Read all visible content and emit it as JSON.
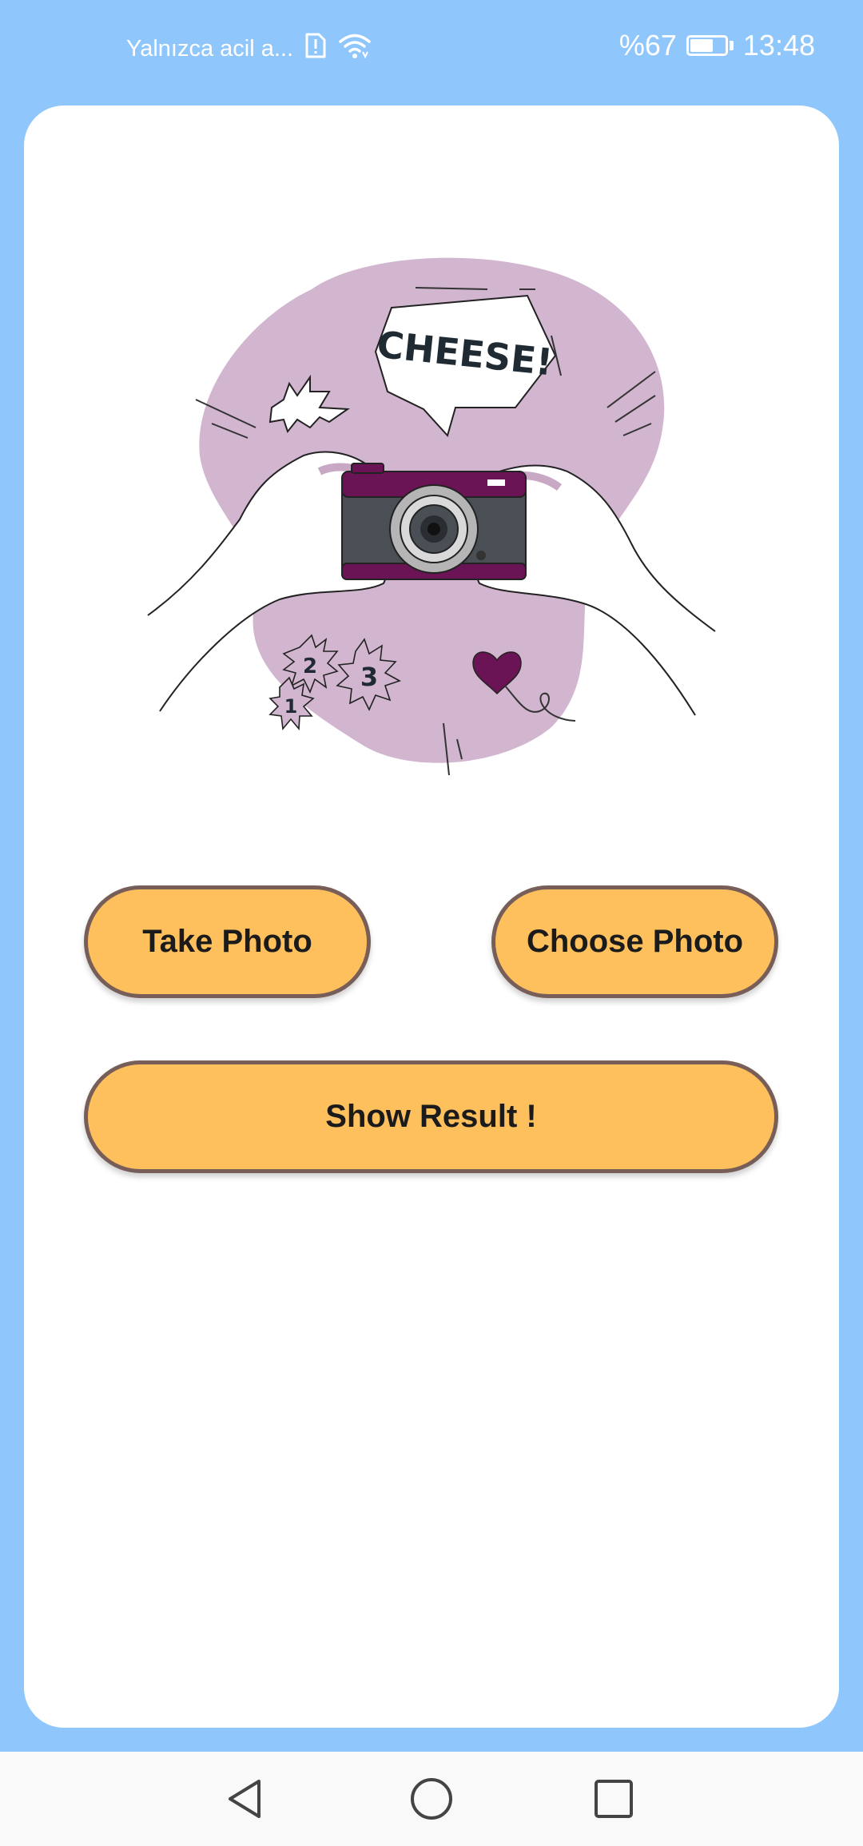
{
  "status_bar": {
    "carrier_text": "Yalnızca acil a...",
    "battery_text": "%67",
    "battery_level": 0.67,
    "time": "13:48",
    "icons": [
      "sim-alert-icon",
      "wifi-icon",
      "battery-charging-icon"
    ]
  },
  "illustration": {
    "speech_bubble_text": "CHEESE!",
    "countdown": [
      "1",
      "2",
      "3"
    ],
    "icons": [
      "camera-icon",
      "hands-icon",
      "heart-icon"
    ]
  },
  "buttons": {
    "take_photo": "Take Photo",
    "choose_photo": "Choose Photo",
    "show_result": "Show Result !"
  },
  "nav_bar": {
    "icons": [
      "back-icon",
      "home-icon",
      "recents-icon"
    ]
  },
  "colors": {
    "background": "#8fc7fd",
    "card": "#ffffff",
    "button_fill": "#fec05d",
    "button_border": "#775e58",
    "blob": "#d2b5cf",
    "camera_accent": "#6b1455"
  }
}
